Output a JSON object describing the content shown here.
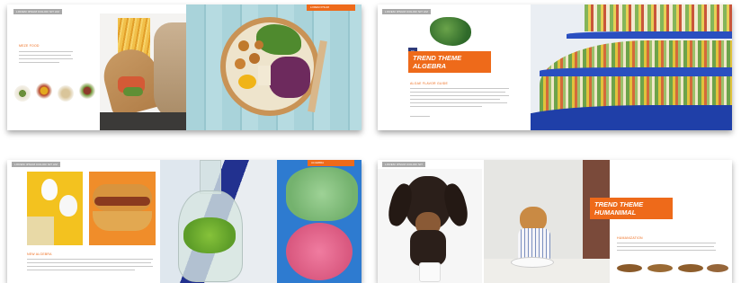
{
  "colors": {
    "accent": "#ee6a1a",
    "gray_tag": "#a9a9a9"
  },
  "slides": [
    {
      "top_tag": "LOREM IPSUM DOLOR SIT AM",
      "section_title": "MEZE FOOD",
      "corner_tag": "LOREM IPSUM"
    },
    {
      "top_tag": "LOREM IPSUM DOLOR SIT AM",
      "badge": "DE",
      "banner_line1": "TREND THEME",
      "banner_line2": "ALGEBRA",
      "section_title": "ALGAE FLAVOR GUIDE"
    },
    {
      "top_tag": "LOREM IPSUM DOLOR SIT AM",
      "section_title": "NEW ALGEBRA",
      "corner_tag": "ALGEBRA"
    },
    {
      "top_tag": "LOREM IPSUM DOLOR SIT",
      "banner_line1": "TREND THEME",
      "banner_line2": "HUMANIMAL",
      "section_title": "HUMANIZATION"
    }
  ]
}
